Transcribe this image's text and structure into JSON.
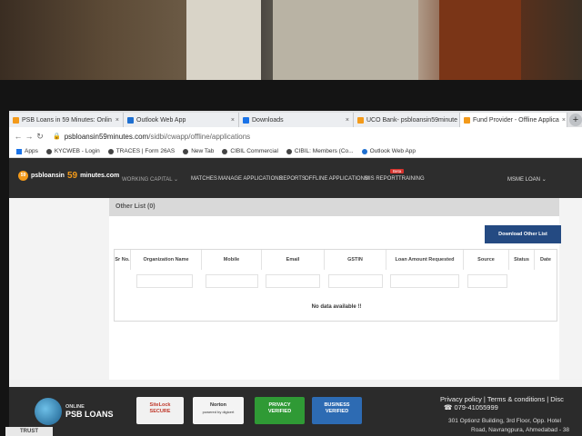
{
  "browser": {
    "tabs": [
      {
        "title": "PSB Loans in 59 Minutes: Onlin",
        "color": "#f39a1a",
        "active": false
      },
      {
        "title": "Outlook Web App",
        "color": "#1e6fd0",
        "active": false
      },
      {
        "title": "Downloads",
        "color": "#1a73e8",
        "active": false
      },
      {
        "title": "UCO Bank- psbloansin59minute",
        "color": "#f39a1a",
        "active": false
      },
      {
        "title": "Fund Provider - Offline Applica",
        "color": "#f39a1a",
        "active": true
      }
    ],
    "tab_close": "×",
    "new_tab": "+",
    "url_host": "psbloansin59minutes.com",
    "url_path": "/sidbi/cwapp/offline/applications",
    "bookmarks": [
      {
        "label": "Apps"
      },
      {
        "label": "KYCWEB - Login"
      },
      {
        "label": "TRACES | Form 26AS"
      },
      {
        "label": "New Tab"
      },
      {
        "label": "CIBIL Commercial"
      },
      {
        "label": "CIBIL: Members (Co..."
      },
      {
        "label": "Outlook Web App"
      }
    ]
  },
  "site": {
    "logo_small": "psbloansin",
    "logo_big": "59",
    "logo_rest": "minutes.com",
    "logo_badge": "59",
    "menu": {
      "working_capital": "WORKING CAPITAL",
      "matches": "MATCHES",
      "manage": "MANAGE APPLICATIONS",
      "reports": "REPORTS",
      "offline": "OFFLINE APPLICATIONS",
      "mis": "MIS REPORT",
      "training": "TRAINING",
      "beta": "Beta",
      "msme": "MSME LOAN"
    }
  },
  "panel": {
    "title": "Other List (0)",
    "download_button": "Download Other List",
    "columns": [
      "Sr No.",
      "Organization Name",
      "Mobile",
      "Email",
      "GSTIN",
      "Loan Amount Requested",
      "Source",
      "Status",
      "Date"
    ],
    "empty_message": "No data available !!"
  },
  "footer": {
    "brand_top": "ONLINE",
    "brand_bottom": "PSB LOANS",
    "badges": [
      {
        "line1": "SiteLock",
        "line2": "SECURE",
        "bg": "#f1f1f1",
        "fg": "#c0392b"
      },
      {
        "line1": "Norton",
        "line2": "powered by digicert",
        "bg": "#f4f4f4",
        "fg": "#333333"
      },
      {
        "line1": "PRIVACY",
        "line2": "VERIFIED",
        "bg": "#2f9a35",
        "fg": "#ffffff"
      },
      {
        "line1": "BUSINESS",
        "line2": "VERIFIED",
        "bg": "#2d6bb3",
        "fg": "#ffffff"
      }
    ],
    "links": "Privacy policy | Terms & conditions | Disc",
    "phone": "079-41055999",
    "address_line1": "301 Optionz Building, 3rd Floor, Opp. Hotel",
    "address_line2": "Road, Navrangpura, Ahmedabad - 38",
    "trust": "TRUST"
  }
}
